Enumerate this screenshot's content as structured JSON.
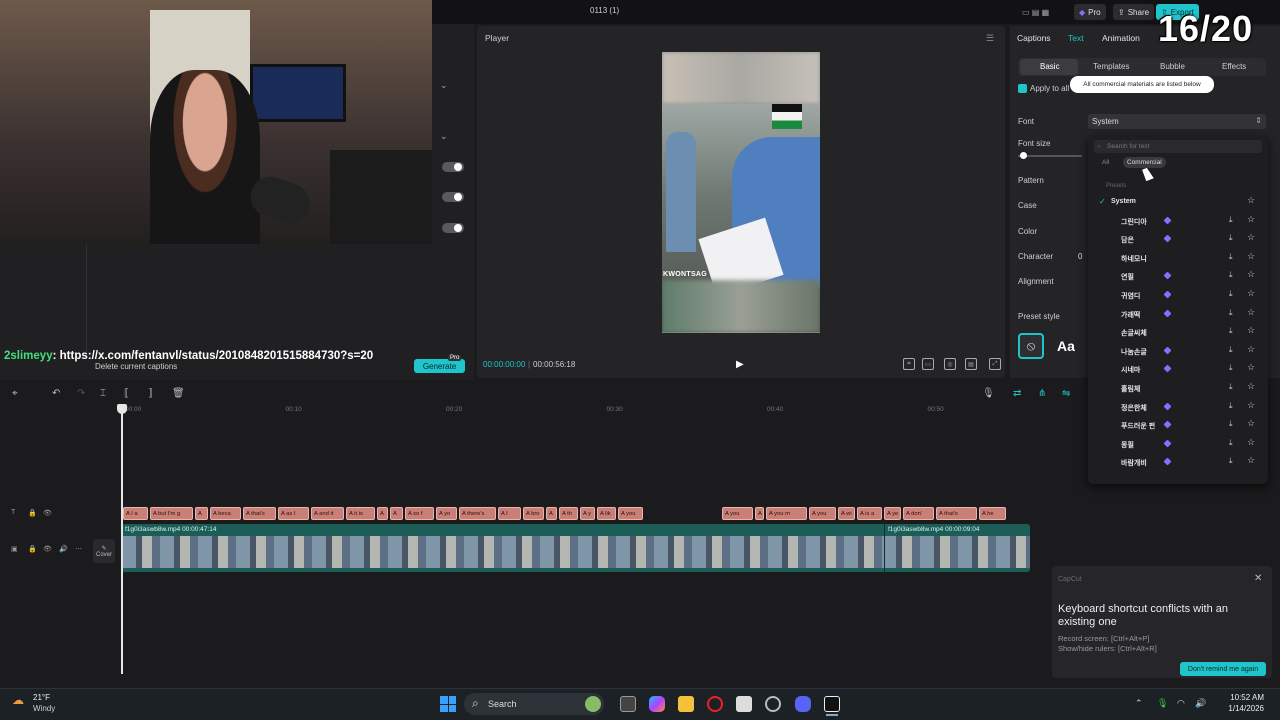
{
  "window": {
    "title": "0113 (1)",
    "pro_label": "Pro",
    "share_label": "Share",
    "export_label": "Export"
  },
  "overlay": {
    "timer": "16/20",
    "chat_user": "2slimeyy",
    "chat_text": ": https://x.com/fentanvl/status/2010848201515884730?s=20"
  },
  "left_panel": {
    "delete_captions": "Delete current captions",
    "generate": "Generate",
    "pro_badge": "Pro"
  },
  "player": {
    "label": "Player",
    "video_watermark": "KWONTSAG",
    "time_current": "00:00:00:00",
    "time_total": "00:00:56:18"
  },
  "right_panel": {
    "tabs": [
      "Captions",
      "Text",
      "Animation"
    ],
    "active_tab": "Text",
    "subtabs": [
      "Basic",
      "Templates",
      "Bubble",
      "Effects"
    ],
    "apply_all": "Apply to all",
    "tooltip": "All commercial materials are listed below",
    "labels": {
      "font": "Font",
      "font_size": "Font size",
      "pattern": "Pattern",
      "case": "Case",
      "color": "Color",
      "character": "Character",
      "alignment": "Alignment",
      "preset_style": "Preset style"
    },
    "character_value": "0",
    "font_value": "System",
    "preset_aa": "Aa"
  },
  "font_dropdown": {
    "search_placeholder": "Search for text",
    "filter_all": "All",
    "filter_commercial": "Commercial",
    "presets_label": "Presets",
    "fonts": [
      {
        "name": "System",
        "selected": true,
        "pro": false
      },
      {
        "name": "그린디아",
        "selected": false,
        "pro": true
      },
      {
        "name": "담은",
        "selected": false,
        "pro": true
      },
      {
        "name": "하네모니",
        "selected": false,
        "pro": false
      },
      {
        "name": "연필",
        "selected": false,
        "pro": true
      },
      {
        "name": "귀염디",
        "selected": false,
        "pro": true
      },
      {
        "name": "가래떡",
        "selected": false,
        "pro": true
      },
      {
        "name": "손글씨체",
        "selected": false,
        "pro": false
      },
      {
        "name": "나눔손글",
        "selected": false,
        "pro": true
      },
      {
        "name": "시네마",
        "selected": false,
        "pro": true
      },
      {
        "name": "흘림체",
        "selected": false,
        "pro": false
      },
      {
        "name": "정은한체",
        "selected": false,
        "pro": true
      },
      {
        "name": "푸드러운 펀",
        "selected": false,
        "pro": true
      },
      {
        "name": "몽필",
        "selected": false,
        "pro": true
      },
      {
        "name": "바람개비",
        "selected": false,
        "pro": true
      }
    ]
  },
  "timeline": {
    "ticks": [
      "00:00",
      "00:10",
      "00:20",
      "00:30",
      "00:40",
      "00:50"
    ],
    "caption_clips": [
      "A I a",
      "A but I'm g",
      "A ",
      "A beca",
      "A that's",
      "A as I",
      "A and it",
      "A it is",
      "A ",
      "A ",
      "A so f",
      "A yo",
      "A there's",
      "A I",
      "A bro",
      "A ",
      "A th",
      "A y",
      "A lik",
      "A you",
      "A you",
      "A I",
      "A you m",
      "A you",
      "A wi",
      "A is a",
      "A ye",
      "A don'",
      "A that's",
      "A he"
    ],
    "clip1_label": "f1g0i3aswb8w.mp4  00:00:47:14",
    "clip2_label": "f1g0i3aswb8w.mp4  00:00:09:04",
    "cover_label": "Cover"
  },
  "notification": {
    "app": "CapCut",
    "title": "Keyboard shortcut conflicts with an existing one",
    "line1": "Record screen: [Ctrl+Alt+P]",
    "line2": "Show/hide rulers: [Ctrl+Alt+R]",
    "button": "Don't remind me again"
  },
  "taskbar": {
    "temp": "21°F",
    "weather": "Windy",
    "search": "Search",
    "time": "10:52 AM",
    "date": "1/14/2026"
  },
  "colors": {
    "accent": "#20c4cb",
    "caption_clip": "#c97f76",
    "video_track": "#1c5e57"
  }
}
